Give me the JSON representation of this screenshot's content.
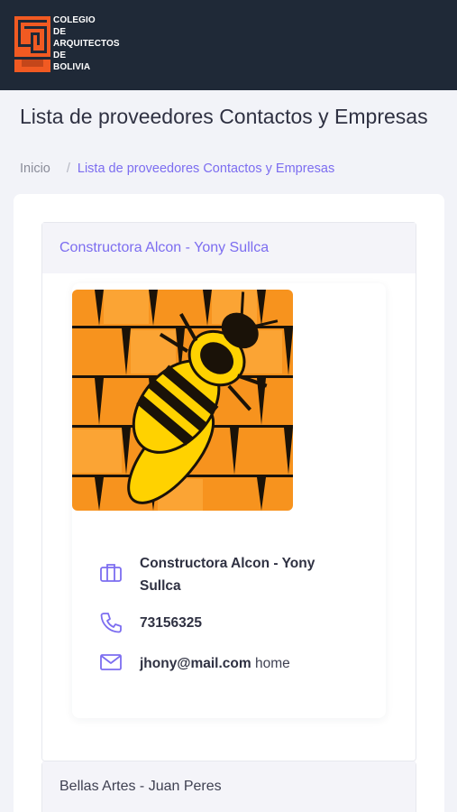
{
  "header": {
    "logo_lines": [
      "COLEGIO",
      "DE",
      "ARQUITECTOS",
      "DE",
      "BOLIVIA"
    ],
    "background": "#1f2937",
    "logo_color": "#f15a22"
  },
  "page": {
    "title": "Lista de proveedores Contactos y Empresas",
    "breadcrumb": {
      "home": "Inicio",
      "separator": "/",
      "current": "Lista de proveedores Contactos y Empresas"
    }
  },
  "providers": [
    {
      "header": "Constructora Alcon - Yony Sullca",
      "expanded": true,
      "company_line1": "Constructora Alcon - Yony",
      "company_line2": "Sullca",
      "phone": "73156325",
      "email": "jhony@mail.com",
      "email_label": "home",
      "icons": {
        "company": "briefcase-icon",
        "phone": "phone-icon",
        "email": "mail-icon"
      }
    },
    {
      "header": "Bellas Artes - Juan Peres",
      "expanded": false
    }
  ],
  "colors": {
    "accent": "#7c6df0",
    "page_bg": "#f2f3f8",
    "text_dark": "#2f3142"
  }
}
